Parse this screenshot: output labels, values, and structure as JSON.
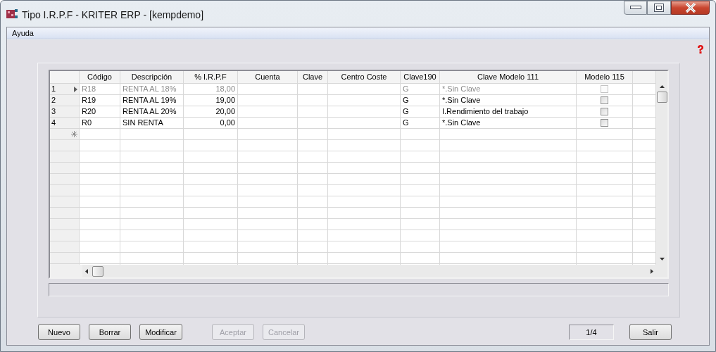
{
  "window": {
    "title": "Tipo I.R.P.F - KRITER ERP - [kempdemo]"
  },
  "menu": [
    {
      "label": "Ayuda"
    }
  ],
  "table": {
    "columns": [
      {
        "label": "Código",
        "kind": "text"
      },
      {
        "label": "Descripción",
        "kind": "text"
      },
      {
        "label": "% I.R.P.F",
        "kind": "number"
      },
      {
        "label": "Cuenta",
        "kind": "text"
      },
      {
        "label": "Clave",
        "kind": "text"
      },
      {
        "label": "Centro Coste",
        "kind": "text"
      },
      {
        "label": "Clave190",
        "kind": "text"
      },
      {
        "label": "Clave Modelo 111",
        "kind": "text"
      },
      {
        "label": "Modelo 115",
        "kind": "check"
      }
    ],
    "rows": [
      {
        "number": "1",
        "current": true,
        "cells": [
          "R18",
          "RENTA AL 18%",
          "18,00",
          "",
          "",
          "",
          "G",
          "*.Sin Clave"
        ],
        "checked": false
      },
      {
        "number": "2",
        "current": false,
        "cells": [
          "R19",
          "RENTA AL 19%",
          "19,00",
          "",
          "",
          "",
          "G",
          "*.Sin Clave"
        ],
        "checked": false
      },
      {
        "number": "3",
        "current": false,
        "cells": [
          "R20",
          "RENTA AL 20%",
          "20,00",
          "",
          "",
          "",
          "G",
          "I.Rendimiento del trabajo"
        ],
        "checked": false
      },
      {
        "number": "4",
        "current": false,
        "cells": [
          "R0",
          "SIN RENTA",
          "0,00",
          "",
          "",
          "",
          "G",
          "*.Sin Clave"
        ],
        "checked": false
      }
    ]
  },
  "buttons": [
    {
      "label": "Nuevo",
      "disabled": false
    },
    {
      "label": "Borrar",
      "disabled": false
    },
    {
      "label": "Modificar",
      "disabled": false
    },
    {
      "label": "Aceptar",
      "disabled": true
    },
    {
      "label": "Cancelar",
      "disabled": true
    }
  ],
  "record_counter": "1/4",
  "exit_button": {
    "label": "Salir",
    "disabled": false
  }
}
